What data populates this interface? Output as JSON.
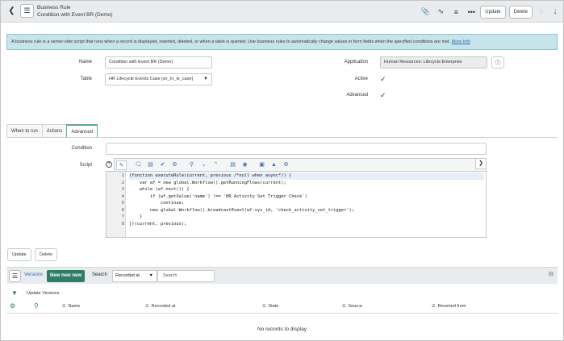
{
  "header": {
    "title_line1": "Business Rule",
    "title_line2": "Condition with Event BR (Demo)",
    "update_label": "Update",
    "delete_label": "Delete"
  },
  "banner": {
    "text": "A business rule is a server-side script that runs when a record is displayed, inserted, deleted, or when a table is queried. Use business rules to automatically change values in form fields when the specified conditions are met. ",
    "link": "More Info"
  },
  "form": {
    "name_label": "Name",
    "name_value": "Condition with Event BR (Demo)",
    "table_label": "Table",
    "table_value": "HR Lifecycle Events Case [sn_hr_le_case]",
    "application_label": "Application",
    "application_value": "Human Resources: Lifecycle Enterprise",
    "active_label": "Active",
    "advanced_label": "Advanced"
  },
  "tabs": [
    "When to run",
    "Actions",
    "Advanced"
  ],
  "advanced": {
    "condition_label": "Condition",
    "script_label": "Script",
    "code": [
      "(function executeRule(current, previous /*null when async*/) {",
      "    var wf = new global.Workflow().getRunningFlows(current);",
      "    while (wf.next()) {",
      "        if (wf.getValue('name') !== 'HR Activity Set Trigger Check')",
      "            continue;",
      "        new global.Workflow().broadcastEvent(wf.sys_id, 'check_activity_set_trigger');",
      "    }",
      "})(current, previous);"
    ],
    "line_numbers": [
      "1",
      "2",
      "3",
      "4",
      "5",
      "6",
      "7",
      "8"
    ]
  },
  "bottom_buttons": {
    "update_label": "Update",
    "delete_label": "Delete"
  },
  "related_list": {
    "tab_label": "Versions",
    "new_label": "New new new",
    "search_label": "Search",
    "search_field": "Recorded at",
    "search_placeholder": "Search",
    "filter_text": "Update Versions",
    "columns": [
      "Name",
      "Recorded at",
      "State",
      "Source",
      "Reverted from"
    ],
    "empty_text": "No records to display"
  }
}
